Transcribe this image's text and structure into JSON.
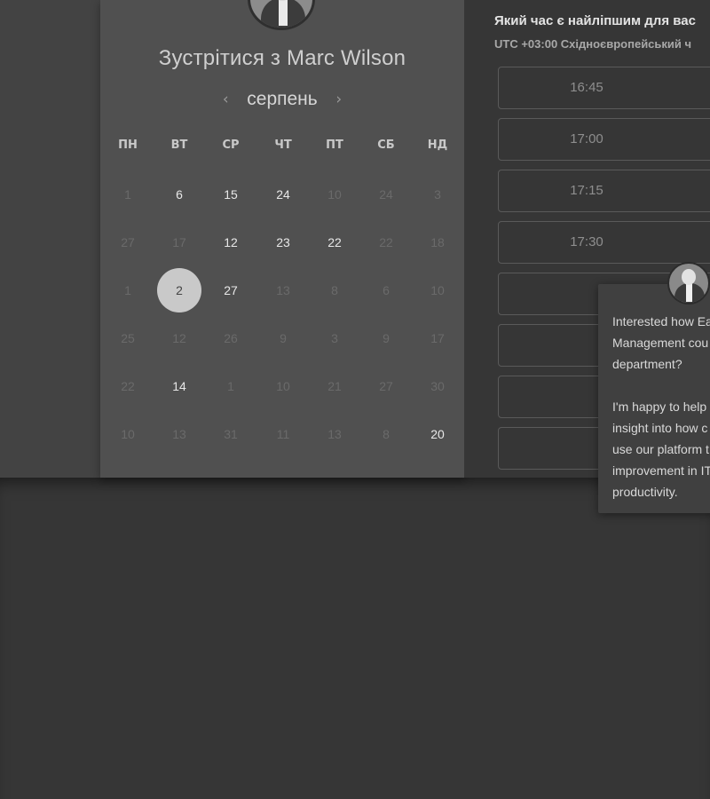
{
  "meeting": {
    "title": "Зустрітися з Marc Wilson",
    "month": "серпень",
    "prev_icon": "‹",
    "next_icon": "›"
  },
  "weekdays": [
    "ПН",
    "ВТ",
    "СР",
    "ЧТ",
    "ПТ",
    "СБ",
    "НД"
  ],
  "calendar": {
    "weeks": [
      [
        {
          "d": "1",
          "on": false
        },
        {
          "d": "6",
          "on": true
        },
        {
          "d": "15",
          "on": true
        },
        {
          "d": "24",
          "on": true
        },
        {
          "d": "10",
          "on": false
        },
        {
          "d": "24",
          "on": false
        },
        {
          "d": "3",
          "on": false
        }
      ],
      [
        {
          "d": "27",
          "on": false
        },
        {
          "d": "17",
          "on": false
        },
        {
          "d": "12",
          "on": true
        },
        {
          "d": "23",
          "on": true
        },
        {
          "d": "22",
          "on": true
        },
        {
          "d": "22",
          "on": false
        },
        {
          "d": "18",
          "on": false
        }
      ],
      [
        {
          "d": "1",
          "on": false
        },
        {
          "d": "2",
          "on": true,
          "selected": true
        },
        {
          "d": "27",
          "on": true
        },
        {
          "d": "13",
          "on": false
        },
        {
          "d": "8",
          "on": false
        },
        {
          "d": "6",
          "on": false
        },
        {
          "d": "10",
          "on": false
        }
      ],
      [
        {
          "d": "25",
          "on": false
        },
        {
          "d": "12",
          "on": false
        },
        {
          "d": "26",
          "on": false
        },
        {
          "d": "9",
          "on": false
        },
        {
          "d": "3",
          "on": false
        },
        {
          "d": "9",
          "on": false
        },
        {
          "d": "17",
          "on": false
        }
      ],
      [
        {
          "d": "22",
          "on": false
        },
        {
          "d": "14",
          "on": true
        },
        {
          "d": "1",
          "on": false
        },
        {
          "d": "10",
          "on": false
        },
        {
          "d": "21",
          "on": false
        },
        {
          "d": "27",
          "on": false
        },
        {
          "d": "30",
          "on": false
        }
      ],
      [
        {
          "d": "10",
          "on": false
        },
        {
          "d": "13",
          "on": false
        },
        {
          "d": "31",
          "on": false
        },
        {
          "d": "11",
          "on": false
        },
        {
          "d": "13",
          "on": false
        },
        {
          "d": "8",
          "on": false
        },
        {
          "d": "20",
          "on": true
        }
      ]
    ]
  },
  "times": {
    "heading": "Який час є найліпшим для вас",
    "timezone": "UTC +03:00 Східноєвропейський ч",
    "slots": [
      "16:45",
      "17:00",
      "17:15",
      "17:30",
      "",
      "",
      "",
      ""
    ]
  },
  "chat": {
    "text": "Interested how Ea\nManagement cou\ndepartment?\n\nI'm happy to help\ninsight into how c\nuse our platform t\nimprovement in IT\nproductivity."
  }
}
